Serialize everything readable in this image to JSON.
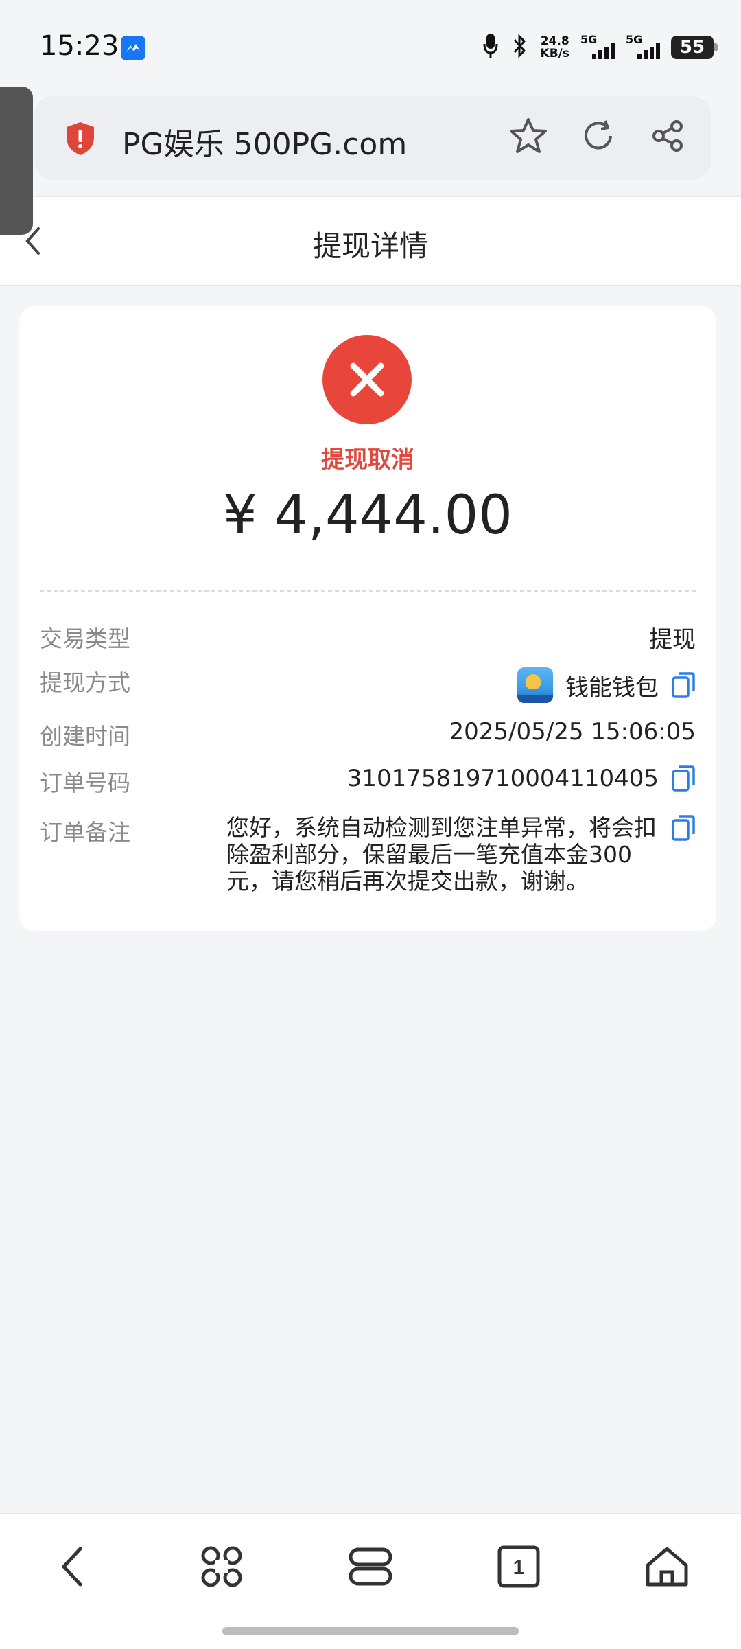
{
  "status_bar": {
    "time": "15:23",
    "network_speed_value": "24.8",
    "network_speed_unit": "KB/s",
    "sim1_label": "5G",
    "sim2_label": "5G",
    "battery": "55",
    "icons": [
      "messenger-icon",
      "microphone-icon",
      "bluetooth-icon",
      "signal-icon",
      "battery-icon"
    ]
  },
  "browser": {
    "url_text": "PG娱乐 500PG.com",
    "icons": [
      "shield-warning-icon",
      "star-icon",
      "refresh-icon",
      "share-icon"
    ]
  },
  "header": {
    "title": "提现详情"
  },
  "status": {
    "text": "提现取消",
    "amount": "¥ 4,444.00",
    "color": "#e8463a"
  },
  "details": {
    "transaction_type": {
      "label": "交易类型",
      "value": "提现"
    },
    "withdraw_method": {
      "label": "提现方式",
      "value": "钱能钱包"
    },
    "created_time": {
      "label": "创建时间",
      "value": "2025/05/25 15:06:05"
    },
    "order_number": {
      "label": "订单号码",
      "value": "310175819710004110405"
    },
    "order_remark": {
      "label": "订单备注",
      "value": "您好，系统自动检测到您注单异常，将会扣除盈利部分，保留最后一笔充值本金300元，请您稍后再次提交出款，谢谢。"
    }
  },
  "bottom_nav": {
    "tab_count": "1",
    "icons": [
      "back-icon",
      "menu-icon",
      "tabs-overview-icon",
      "tab-count-icon",
      "home-icon"
    ]
  }
}
